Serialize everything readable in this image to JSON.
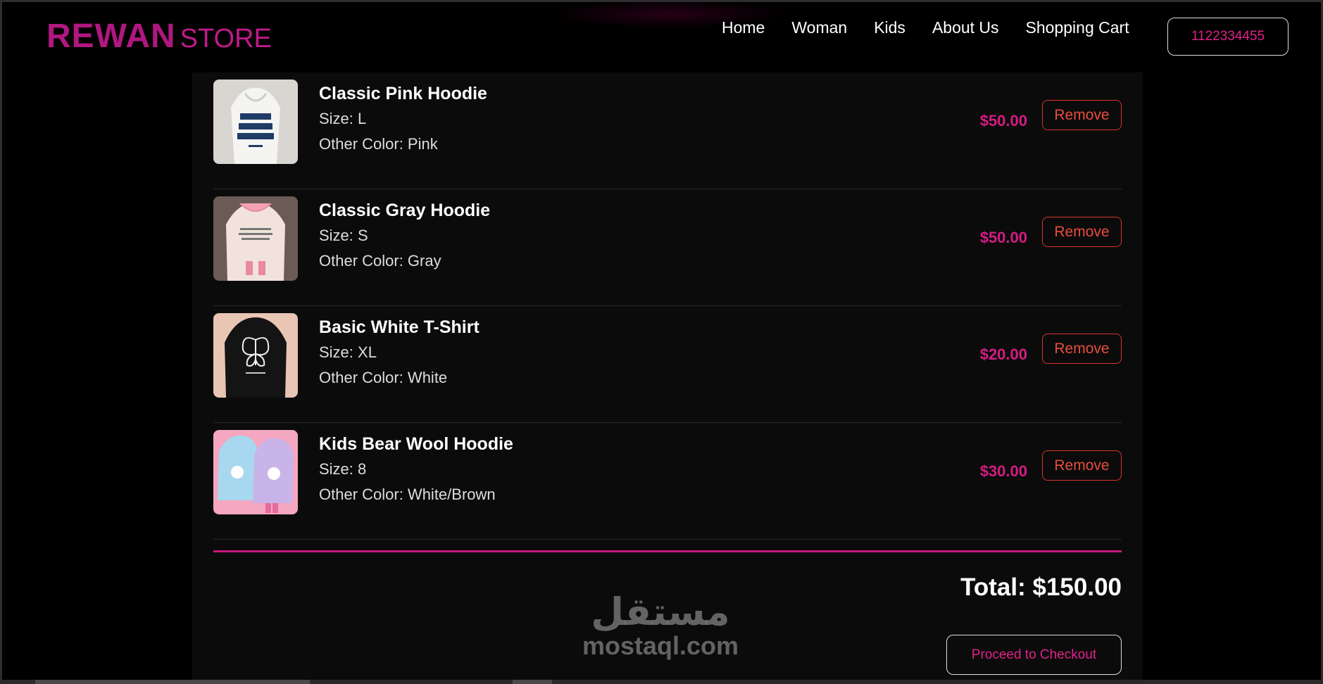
{
  "brand": {
    "main": "REWAN",
    "sub": "STORE",
    "color": "#b0177f"
  },
  "nav": {
    "items": [
      "Home",
      "Woman",
      "Kids",
      "About Us",
      "Shopping Cart"
    ]
  },
  "header": {
    "phone_label": "1122334455"
  },
  "cart": {
    "items": [
      {
        "name": "Classic Pink Hoodie",
        "size": "Size: L",
        "color": "Other Color: Pink",
        "price": "$50.00",
        "remove_label": "Remove",
        "image": "white-hoodie-text-print"
      },
      {
        "name": "Classic Gray Hoodie",
        "size": "Size: S",
        "color": "Other Color: Gray",
        "price": "$50.00",
        "remove_label": "Remove",
        "image": "cream-pink-hoodie"
      },
      {
        "name": "Basic White T-Shirt",
        "size": "Size: XL",
        "color": "Other Color: White",
        "price": "$20.00",
        "remove_label": "Remove",
        "image": "black-butterfly-hoodie"
      },
      {
        "name": "Kids Bear Wool Hoodie",
        "size": "Size: 8",
        "color": "Other Color: White/Brown",
        "price": "$30.00",
        "remove_label": "Remove",
        "image": "kids-pastel-hoodies"
      }
    ],
    "total": "Total: $150.00",
    "checkout_label": "Proceed to Checkout"
  },
  "watermark": {
    "arabic": "مستقل",
    "latin": "mostaql.com"
  },
  "colors": {
    "accent": "#d41c84",
    "danger": "#e74c3c",
    "panel": "#0b0b0b",
    "background": "#000000"
  }
}
